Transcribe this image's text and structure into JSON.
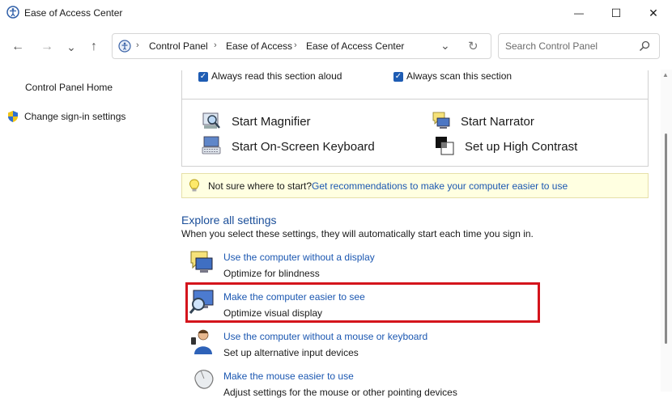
{
  "window": {
    "title": "Ease of Access Center",
    "minimize_glyph": "—",
    "maximize_glyph": "☐",
    "close_glyph": "✕"
  },
  "nav": {
    "back_glyph": "←",
    "forward_glyph": "→",
    "recent_glyph": "⌄",
    "up_glyph": "↑"
  },
  "address": {
    "path": [
      "Control Panel",
      "Ease of Access",
      "Ease of Access Center"
    ],
    "separator": "›",
    "dropdown_glyph": "⌄",
    "refresh_glyph": "↻"
  },
  "search": {
    "placeholder": "Search Control Panel"
  },
  "left_nav": {
    "home": "Control Panel Home",
    "signin": "Change sign-in settings"
  },
  "quick": {
    "read_aloud": "Always read this section aloud",
    "scan": "Always scan this section",
    "magnifier": "Start Magnifier",
    "narrator": "Start Narrator",
    "osk": "Start On-Screen Keyboard",
    "contrast": "Set up High Contrast"
  },
  "tip": {
    "lead": "Not sure where to start?",
    "link": "Get recommendations to make your computer easier to use"
  },
  "explore": {
    "title": "Explore all settings",
    "subtitle": "When you select these settings, they will automatically start each time you sign in.",
    "items": [
      {
        "link": "Use the computer without a display",
        "desc": "Optimize for blindness"
      },
      {
        "link": "Make the computer easier to see",
        "desc": "Optimize visual display"
      },
      {
        "link": "Use the computer without a mouse or keyboard",
        "desc": "Set up alternative input devices"
      },
      {
        "link": "Make the mouse easier to use",
        "desc": "Adjust settings for the mouse or other pointing devices"
      }
    ]
  },
  "colors": {
    "link": "#1b57b1",
    "highlight": "#d4141c",
    "tip_bg": "#ffffe1",
    "check": "#1e5cb3"
  }
}
